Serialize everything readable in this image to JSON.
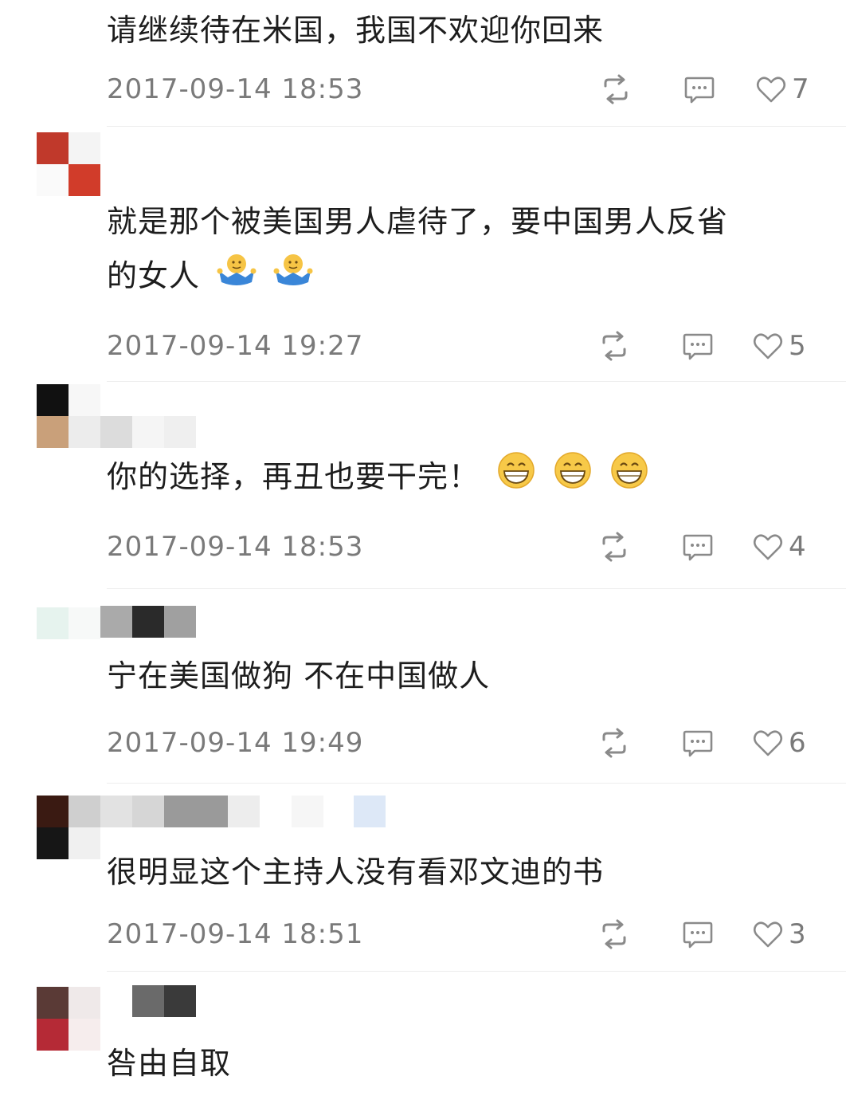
{
  "comments": [
    {
      "text": "请继续待在米国，我国不欢迎你回来",
      "emoji": [],
      "timestamp": "2017-09-14 18:53",
      "likes": "7"
    },
    {
      "text_lines": [
        "就是那个被美国男人虐待了，要中国男人反省",
        "的女人"
      ],
      "emoji": [
        "shrug-emoji",
        "shrug-emoji"
      ],
      "timestamp": "2017-09-14 19:27",
      "likes": "5"
    },
    {
      "text": "你的选择，再丑也要干完！",
      "emoji": [
        "grin-emoji",
        "grin-emoji",
        "grin-emoji"
      ],
      "timestamp": "2017-09-14 18:53",
      "likes": "4"
    },
    {
      "text": "宁在美国做狗 不在中国做人",
      "emoji": [],
      "timestamp": "2017-09-14 19:49",
      "likes": "6"
    },
    {
      "text": "很明显这个主持人没有看邓文迪的书",
      "emoji": [],
      "timestamp": "2017-09-14 18:51",
      "likes": "3"
    },
    {
      "text": "咎由自取",
      "emoji": []
    }
  ],
  "icons": {
    "repost": "repost-icon",
    "reply": "comment-icon",
    "like": "heart-icon"
  },
  "colors": {
    "text": "#1d1d1d",
    "meta": "#7a7a7a",
    "icon": "#8a8a8a"
  }
}
